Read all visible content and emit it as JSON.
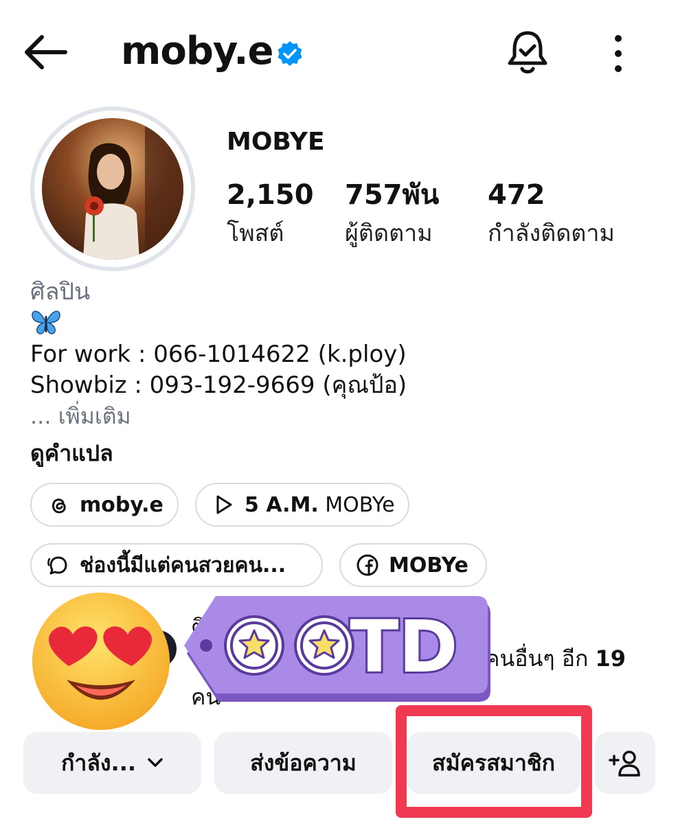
{
  "header": {
    "username": "moby.e",
    "back_icon": "arrow-left-icon",
    "verified_icon": "verified-badge-icon",
    "bell_icon": "bell-check-icon",
    "more_icon": "more-vertical-icon"
  },
  "profile": {
    "display_name": "MOBYE",
    "stats": [
      {
        "value": "2,150",
        "label": "โพสต์"
      },
      {
        "value": "757พัน",
        "label": "ผู้ติดตาม"
      },
      {
        "value": "472",
        "label": "กำลังติดตาม"
      }
    ]
  },
  "bio": {
    "category": "ศิลปิน",
    "emoji": "butterfly",
    "lines": [
      "For work :  066-1014622 (k.ploy)",
      "Showbiz : 093-192-9669 (คุณป้อ)"
    ],
    "more": "... เพิ่มเติม",
    "translate": "ดูคำแปล"
  },
  "links": [
    {
      "icon": "threads-icon",
      "label": "moby.e",
      "label_light": ""
    },
    {
      "icon": "play-icon",
      "label": "5 A.M.",
      "label_light": " MOBYe"
    },
    {
      "icon": "broadcast-chat-icon",
      "label": "ช่องนี้มีแต่คนสวยคน...",
      "label_light": ""
    },
    {
      "icon": "facebook-icon",
      "label": "MOBYe",
      "label_light": ""
    }
  ],
  "followed_by": {
    "first_char": "ติ",
    "tail_text": "คนอื่นๆ อีก ",
    "tail_count": "19",
    "end_text": "คน"
  },
  "stickers": {
    "tag_text": "TD",
    "emoji": "heart-eyes-face"
  },
  "actions": {
    "following_label": "กำลัง...",
    "message_label": "ส่งข้อความ",
    "subscribe_label": "สมัครสมาชิก",
    "add_person_icon": "add-person-icon"
  },
  "colors": {
    "verified": "#0095f6",
    "button_bg": "#eff1f4",
    "highlight": "#f03a52",
    "sticker_purple": "#a98ae6"
  }
}
